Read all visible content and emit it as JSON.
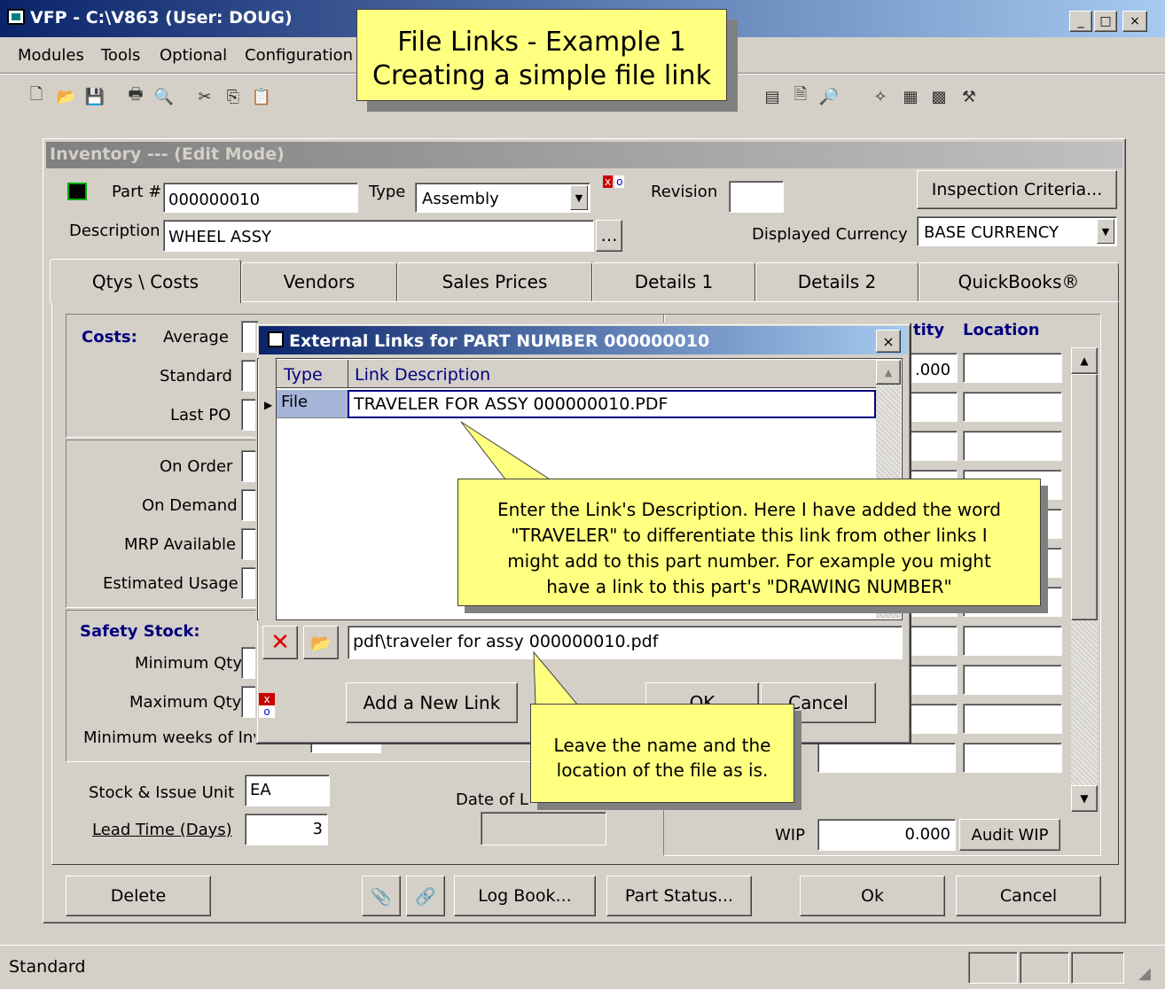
{
  "app": {
    "title": "VFP - C:\\V863  (User: DOUG)",
    "menu": [
      "Modules",
      "Tools",
      "Optional",
      "Configuration"
    ],
    "status_text": "Standard"
  },
  "callout_title": {
    "line1": "File Links - Example 1",
    "line2": "Creating a simple file link"
  },
  "inventory": {
    "title": "Inventory --- (Edit Mode)",
    "part_label": "Part #",
    "part_value": "000000010",
    "type_label": "Type",
    "type_value": "Assembly",
    "revision_label": "Revision",
    "revision_value": "",
    "inspection_button": "Inspection Criteria...",
    "description_label": "Description",
    "description_value": "WHEEL ASSY",
    "currency_label": "Displayed Currency",
    "currency_value": "BASE CURRENCY",
    "tabs": [
      "Qtys \\ Costs",
      "Vendors",
      "Sales Prices",
      "Details 1",
      "Details 2",
      "QuickBooks®"
    ],
    "costs_label": "Costs:",
    "cost_fields": [
      "Average",
      "Standard",
      "Last PO"
    ],
    "order_fields": [
      "On Order",
      "On Demand",
      "MRP Available",
      "Estimated Usage"
    ],
    "safety_label": "Safety Stock:",
    "safety_fields": [
      "Minimum Qty",
      "Maximum Qty"
    ],
    "min_weeks_label": "Minimum weeks of Inv",
    "stock_unit_label": "Stock & Issue Unit",
    "stock_unit_value": "EA",
    "lead_time_label": "Lead Time (Days)",
    "lead_time_value": "3",
    "date_label": "Date of L",
    "qty_header": "tity",
    "location_header": "Location",
    "first_qty": ".000",
    "wip_label": "WIP",
    "wip_value": "0.000",
    "audit_wip_button": "Audit WIP",
    "bottom_buttons": [
      "Delete",
      "Log Book...",
      "Part Status...",
      "Ok",
      "Cancel"
    ]
  },
  "links_dialog": {
    "title": "External Links for PART NUMBER 000000010",
    "col_type": "Type",
    "col_desc": "Link Description",
    "row_type": "File",
    "row_desc": "TRAVELER FOR ASSY 000000010.PDF",
    "path_value": "pdf\\traveler for assy 000000010.pdf",
    "add_button": "Add a New Link",
    "ok_button": "OK",
    "cancel_button": "Cancel"
  },
  "callout_desc": {
    "line1": "Enter the Link's Description.  Here I have added the word",
    "line2": "\"TRAVELER\" to differentiate this link from other links I",
    "line3": "might add to this part number.  For example you might",
    "line4": "have a link to this part's \"DRAWING NUMBER\""
  },
  "callout_path": {
    "line1": "Leave the name and the",
    "line2": "location of the file as is."
  }
}
